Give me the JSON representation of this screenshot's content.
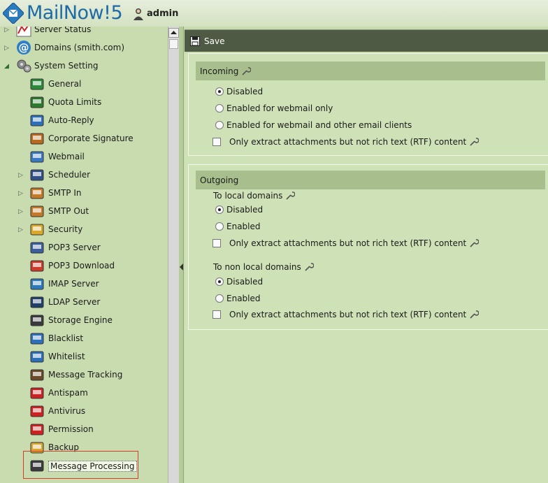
{
  "app": {
    "brand": "MailNow!5",
    "user": "admin"
  },
  "toolbar": {
    "save_label": "Save"
  },
  "sidebar": {
    "partial_top": "Server Status",
    "domains": "Domains (smith.com)",
    "system_setting": "System Setting",
    "items": [
      {
        "label": "General",
        "icon": "globe-icon",
        "expandable": false
      },
      {
        "label": "Quota Limits",
        "icon": "car-icon",
        "expandable": false
      },
      {
        "label": "Auto-Reply",
        "icon": "mail-reply-icon",
        "expandable": false
      },
      {
        "label": "Corporate Signature",
        "icon": "signature-pen-icon",
        "expandable": false
      },
      {
        "label": "Webmail",
        "icon": "webmail-doc-icon",
        "expandable": false
      },
      {
        "label": "Scheduler",
        "icon": "clock-icon",
        "expandable": true
      },
      {
        "label": "SMTP In",
        "icon": "package-in-icon",
        "expandable": true
      },
      {
        "label": "SMTP Out",
        "icon": "package-out-icon",
        "expandable": true
      },
      {
        "label": "Security",
        "icon": "key-lock-icon",
        "expandable": true
      },
      {
        "label": "POP3 Server",
        "icon": "postman-icon",
        "expandable": false
      },
      {
        "label": "POP3 Download",
        "icon": "download-mail-icon",
        "expandable": false
      },
      {
        "label": "IMAP Server",
        "icon": "imap-mail-icon",
        "expandable": false
      },
      {
        "label": "LDAP Server",
        "icon": "ldap-server-icon",
        "expandable": false
      },
      {
        "label": "Storage Engine",
        "icon": "storage-engine-icon",
        "expandable": false
      },
      {
        "label": "Blacklist",
        "icon": "blacklist-mail-icon",
        "expandable": false
      },
      {
        "label": "Whitelist",
        "icon": "whitelist-mail-icon",
        "expandable": false
      },
      {
        "label": "Message Tracking",
        "icon": "tracking-person-icon",
        "expandable": false
      },
      {
        "label": "Antispam",
        "icon": "antispam-stop-icon",
        "expandable": false
      },
      {
        "label": "Antivirus",
        "icon": "antivirus-kit-icon",
        "expandable": false
      },
      {
        "label": "Permission",
        "icon": "permission-hand-icon",
        "expandable": false
      },
      {
        "label": "Backup",
        "icon": "backup-box-icon",
        "expandable": false
      },
      {
        "label": "Message Processing",
        "icon": "message-processing-icon",
        "expandable": false,
        "selected": true
      }
    ]
  },
  "incoming": {
    "title": "Incoming",
    "options": [
      "Disabled",
      "Enabled for webmail only",
      "Enabled for webmail and other email clients"
    ],
    "selected": 0,
    "extract_label": "Only extract attachments but not rich text (RTF) content"
  },
  "outgoing": {
    "title": "Outgoing",
    "local": {
      "label": "To local domains",
      "options": [
        "Disabled",
        "Enabled"
      ],
      "selected": 0,
      "extract_label": "Only extract attachments but not rich text (RTF) content"
    },
    "nonlocal": {
      "label": "To non local domains",
      "options": [
        "Disabled",
        "Enabled"
      ],
      "selected": 0,
      "extract_label": "Only extract attachments but not rich text (RTF) content"
    }
  },
  "colors": {
    "bg": "#c9dcb0",
    "toolbar": "#4e5a44",
    "section_head": "#a8bf8d",
    "brand": "#1e6aa8",
    "selection_box": "#d63c2c"
  }
}
